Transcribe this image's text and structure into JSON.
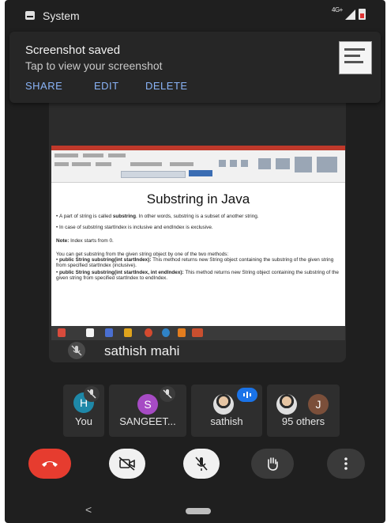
{
  "status_bar": {
    "app_label": "System",
    "network": "4G+"
  },
  "notification": {
    "title": "Screenshot saved",
    "subtitle": "Tap to view your screenshot",
    "actions": {
      "share": "SHARE",
      "edit": "EDIT",
      "delete": "DELETE"
    }
  },
  "presentation": {
    "title": "Substring in Java",
    "bullet1_pre": "A part of string is called ",
    "bullet1_bold": "substring",
    "bullet1_post": ". In other words, substring is a subset of another string.",
    "bullet2": "In case of substring startIndex is inclusive and endIndex is exclusive.",
    "note_label": "Note:",
    "note_text": " Index starts from 0.",
    "para": "You can get substring from the given string object by one of the two methods:",
    "method1_bold": "public String substring(int startIndex):",
    "method1_text": " This method returns new String object containing the substring of the given string from specified startIndex (inclusive).",
    "method2_bold": "public String substring(int startIndex, int endIndex):",
    "method2_text": " This method returns new String object containing the substring of the given string from specified startIndex to endIndex."
  },
  "main_tile": {
    "name": "sathish mahi",
    "mic_muted": true
  },
  "participants": [
    {
      "initial": "H",
      "label": "You",
      "color": "#1e88a8",
      "muted": true
    },
    {
      "initial": "S",
      "label": "SANGEET...",
      "color": "#a64bc4",
      "muted": true
    },
    {
      "label": "sathish",
      "speaking": true
    },
    {
      "initial": "J",
      "label": "95 others",
      "color": "#7b4f3a"
    }
  ],
  "controls": {
    "end_call_icon": "phone-hangup-icon",
    "camera_icon": "video-off-icon",
    "mic_icon": "mic-off-icon",
    "hand_icon": "raise-hand-icon",
    "more_icon": "more-vert-icon"
  },
  "colors": {
    "end_call": "#e63c2f",
    "link": "#8ab4f8",
    "speaking": "#1a73e8"
  },
  "nav": {
    "back_glyph": "<"
  }
}
